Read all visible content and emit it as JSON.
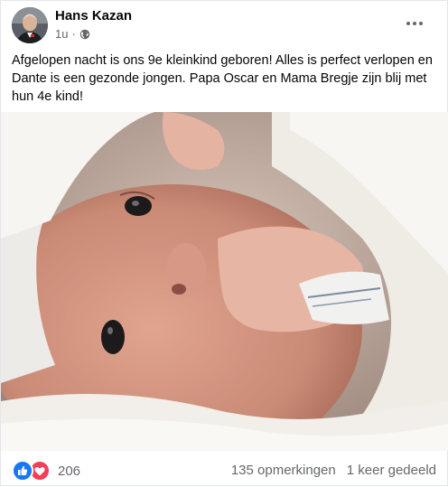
{
  "post": {
    "author": "Hans Kazan",
    "time": "1u",
    "separator": "·",
    "audience_icon": "globe-icon",
    "more_icon": "more-options-icon",
    "text": "Afgelopen nacht is ons 9e kleinkind geboren! Alles is perfect verlopen en Dante is een gezonde jongen. Papa Oscar en Mama Bregje zijn blij met hun 4e kind!"
  },
  "footer": {
    "reaction_icons": [
      "like-icon",
      "love-icon"
    ],
    "reaction_count": "206",
    "comments": "135 opmerkingen",
    "shares": "1 keer gedeeld"
  },
  "colors": {
    "like": "#1877f2",
    "love": "#f33e58",
    "secondary_text": "#65676b"
  }
}
